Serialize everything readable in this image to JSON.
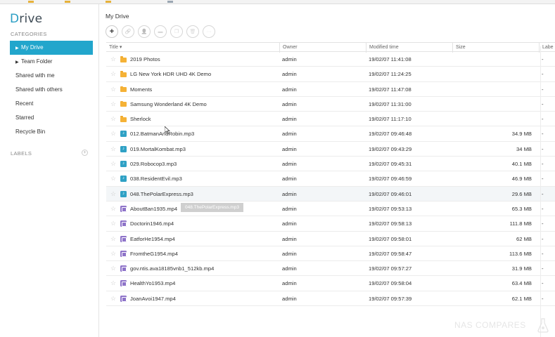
{
  "app": {
    "logo_letter": "D",
    "logo_rest": "rive"
  },
  "sidebar": {
    "categories_title": "CATEGORIES",
    "items": [
      {
        "label": "My Drive",
        "active": true,
        "expandable": true
      },
      {
        "label": "Team Folder",
        "active": false,
        "expandable": true
      },
      {
        "label": "Shared with me",
        "active": false,
        "expandable": false
      },
      {
        "label": "Shared with others",
        "active": false,
        "expandable": false
      },
      {
        "label": "Recent",
        "active": false,
        "expandable": false
      },
      {
        "label": "Starred",
        "active": false,
        "expandable": false
      },
      {
        "label": "Recycle Bin",
        "active": false,
        "expandable": false
      }
    ],
    "labels_title": "LABELS",
    "labels_add_icon": "plus-icon"
  },
  "main": {
    "breadcrumb": "My Drive",
    "toolbar": [
      {
        "name": "create-button",
        "icon": "plus-icon"
      },
      {
        "name": "share-link-button",
        "icon": "link-icon"
      },
      {
        "name": "share-users-button",
        "icon": "user-add-icon"
      },
      {
        "name": "move-button",
        "icon": "folder-icon"
      },
      {
        "name": "copy-button",
        "icon": "copy-icon"
      },
      {
        "name": "delete-button",
        "icon": "trash-icon"
      },
      {
        "name": "more-button",
        "icon": "more-icon"
      }
    ],
    "columns": {
      "title": "Title",
      "owner": "Owner",
      "modified": "Modified time",
      "size": "Size",
      "label": "Labe"
    },
    "files": [
      {
        "type": "folder",
        "title": "2019 Photos",
        "owner": "admin",
        "modified": "19/02/07 11:41:08",
        "size": "",
        "label": "-"
      },
      {
        "type": "folder",
        "title": "LG New York HDR UHD 4K Demo",
        "owner": "admin",
        "modified": "19/02/07 11:24:25",
        "size": "",
        "label": "-"
      },
      {
        "type": "folder",
        "title": "Moments",
        "owner": "admin",
        "modified": "19/02/07 11:47:08",
        "size": "",
        "label": "-"
      },
      {
        "type": "folder",
        "title": "Samsung Wonderland 4K Demo",
        "owner": "admin",
        "modified": "19/02/07 11:31:00",
        "size": "",
        "label": "-"
      },
      {
        "type": "folder",
        "title": "Sherlock",
        "owner": "admin",
        "modified": "19/02/07 11:17:10",
        "size": "",
        "label": "-"
      },
      {
        "type": "audio",
        "title": "012.BatmanAndRobin.mp3",
        "owner": "admin",
        "modified": "19/02/07 09:46:48",
        "size": "34.9 MB",
        "label": "-"
      },
      {
        "type": "audio",
        "title": "019.MortalKombat.mp3",
        "owner": "admin",
        "modified": "19/02/07 09:43:29",
        "size": "34 MB",
        "label": "-"
      },
      {
        "type": "audio",
        "title": "029.Robocop3.mp3",
        "owner": "admin",
        "modified": "19/02/07 09:45:31",
        "size": "40.1 MB",
        "label": "-"
      },
      {
        "type": "audio",
        "title": "038.ResidentEvil.mp3",
        "owner": "admin",
        "modified": "19/02/07 09:46:59",
        "size": "46.9 MB",
        "label": "-"
      },
      {
        "type": "audio",
        "title": "048.ThePolarExpress.mp3",
        "owner": "admin",
        "modified": "19/02/07 09:46:01",
        "size": "29.6 MB",
        "label": "-",
        "hover": true
      },
      {
        "type": "video",
        "title": "AboutBan1935.mp4",
        "owner": "admin",
        "modified": "19/02/07 09:53:13",
        "size": "65.3 MB",
        "label": "-"
      },
      {
        "type": "video",
        "title": "Doctorin1946.mp4",
        "owner": "admin",
        "modified": "19/02/07 09:58:13",
        "size": "111.8 MB",
        "label": "-"
      },
      {
        "type": "video",
        "title": "EatforHe1954.mp4",
        "owner": "admin",
        "modified": "19/02/07 09:58:01",
        "size": "62 MB",
        "label": "-"
      },
      {
        "type": "video",
        "title": "FromtheG1954.mp4",
        "owner": "admin",
        "modified": "19/02/07 09:58:47",
        "size": "113.6 MB",
        "label": "-"
      },
      {
        "type": "video",
        "title": "gov.ntis.ava18185vnb1_512kb.mp4",
        "owner": "admin",
        "modified": "19/02/07 09:57:27",
        "size": "31.9 MB",
        "label": "-"
      },
      {
        "type": "video",
        "title": "HealthYo1953.mp4",
        "owner": "admin",
        "modified": "19/02/07 09:58:04",
        "size": "63.4 MB",
        "label": "-"
      },
      {
        "type": "video",
        "title": "JoanAvoi1947.mp4",
        "owner": "admin",
        "modified": "19/02/07 09:57:39",
        "size": "62.1 MB",
        "label": "-"
      }
    ],
    "tooltip": "048.ThePolarExpress.mp3"
  },
  "watermark": "NAS COMPARES",
  "colors": {
    "accent": "#22a6cc",
    "folder": "#f5b236",
    "audio": "#2fa1c5",
    "video": "#8e73c9"
  }
}
